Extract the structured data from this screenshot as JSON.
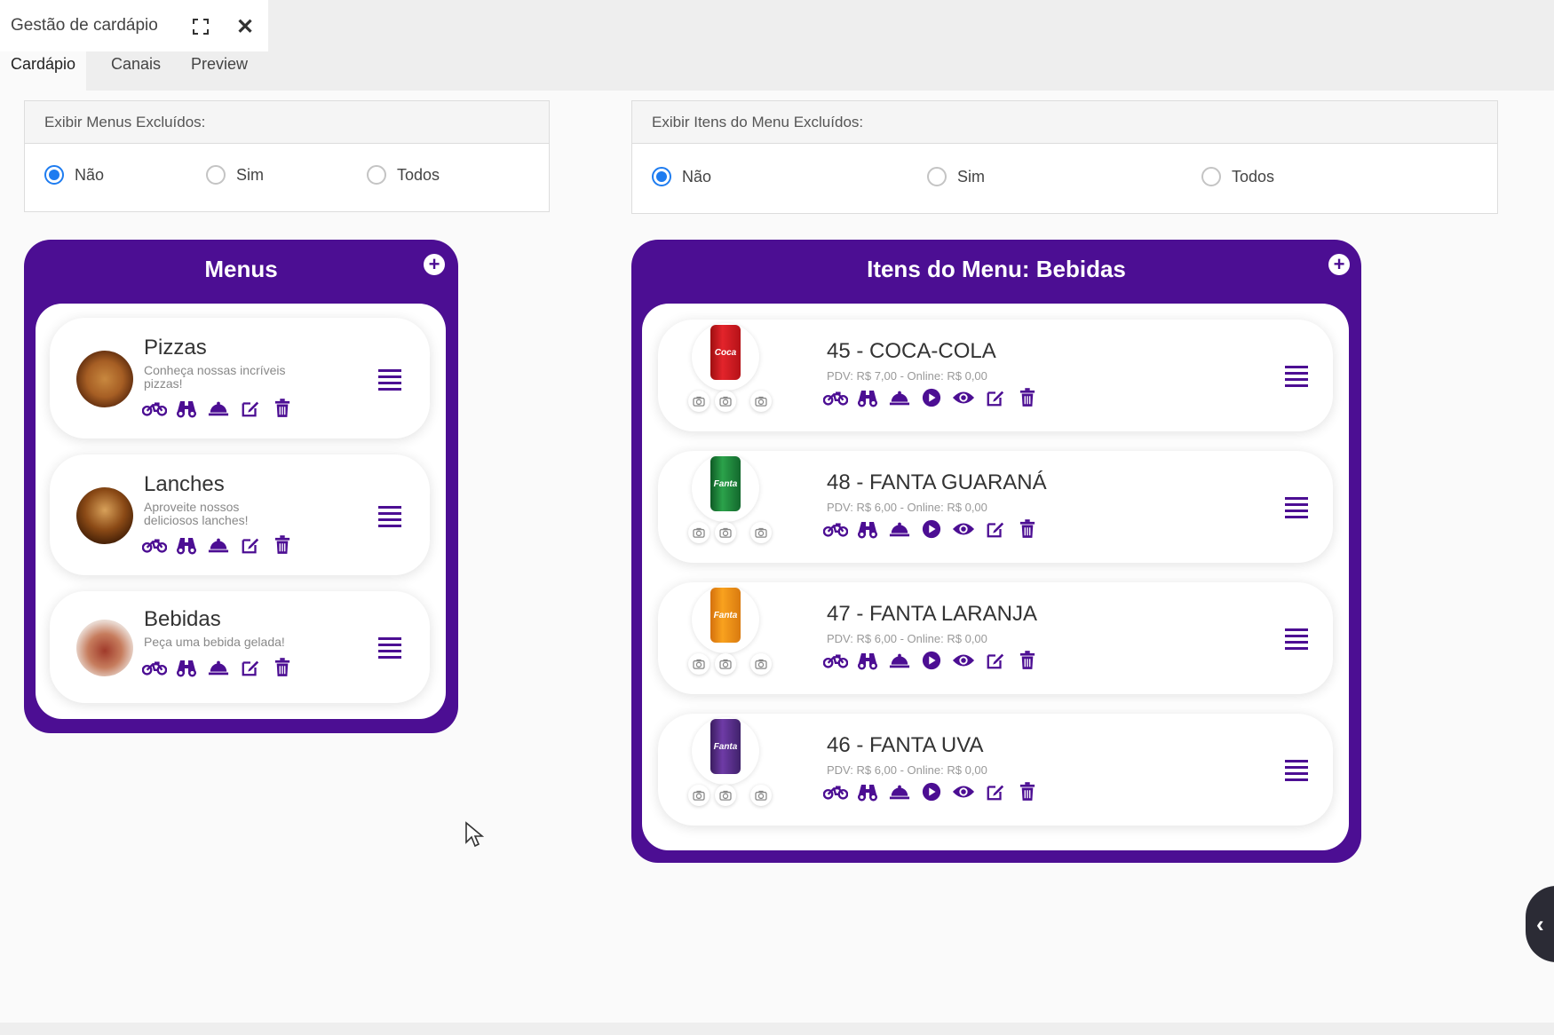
{
  "window": {
    "title": "Gestão de cardápio"
  },
  "tabs": [
    "Cardápio",
    "Canais",
    "Preview"
  ],
  "filters": {
    "menus": {
      "label": "Exibir Menus Excluídos:",
      "options": [
        "Não",
        "Sim",
        "Todos"
      ],
      "selected": "Não"
    },
    "items": {
      "label": "Exibir Itens do Menu Excluídos:",
      "options": [
        "Não",
        "Sim",
        "Todos"
      ],
      "selected": "Não"
    }
  },
  "menus_panel": {
    "title": "Menus",
    "menus": [
      {
        "name": "Pizzas",
        "description": "Conheça nossas incríveis pizzas!"
      },
      {
        "name": "Lanches",
        "description": "Aproveite nossos deliciosos lanches!"
      },
      {
        "name": "Bebidas",
        "description": "Peça uma bebida gelada!"
      }
    ]
  },
  "items_panel": {
    "title": "Itens do Menu: Bebidas",
    "items": [
      {
        "name": "45 - COCA-COLA",
        "price": "PDV: R$ 7,00 - Online: R$ 0,00",
        "image": "coca-cola-can"
      },
      {
        "name": "48 - FANTA GUARANÁ",
        "price": "PDV: R$ 6,00 - Online: R$ 0,00",
        "image": "fanta-guarana-can"
      },
      {
        "name": "47 - FANTA LARANJA",
        "price": "PDV: R$ 6,00 - Online: R$ 0,00",
        "image": "fanta-laranja-can"
      },
      {
        "name": "46 - FANTA UVA",
        "price": "PDV: R$ 6,00 - Online: R$ 0,00",
        "image": "fanta-uva-can"
      }
    ]
  },
  "colors": {
    "brand_purple": "#4c0e93",
    "radio_blue": "#1e7cf0"
  },
  "icons": [
    "expand-icon",
    "close-icon",
    "plus-icon",
    "delivery-icon",
    "binoculars-icon",
    "cloche-icon",
    "play-icon",
    "eye-icon",
    "edit-icon",
    "trash-icon",
    "drag-handle-icon",
    "camera-icon",
    "chevron-left-icon"
  ]
}
